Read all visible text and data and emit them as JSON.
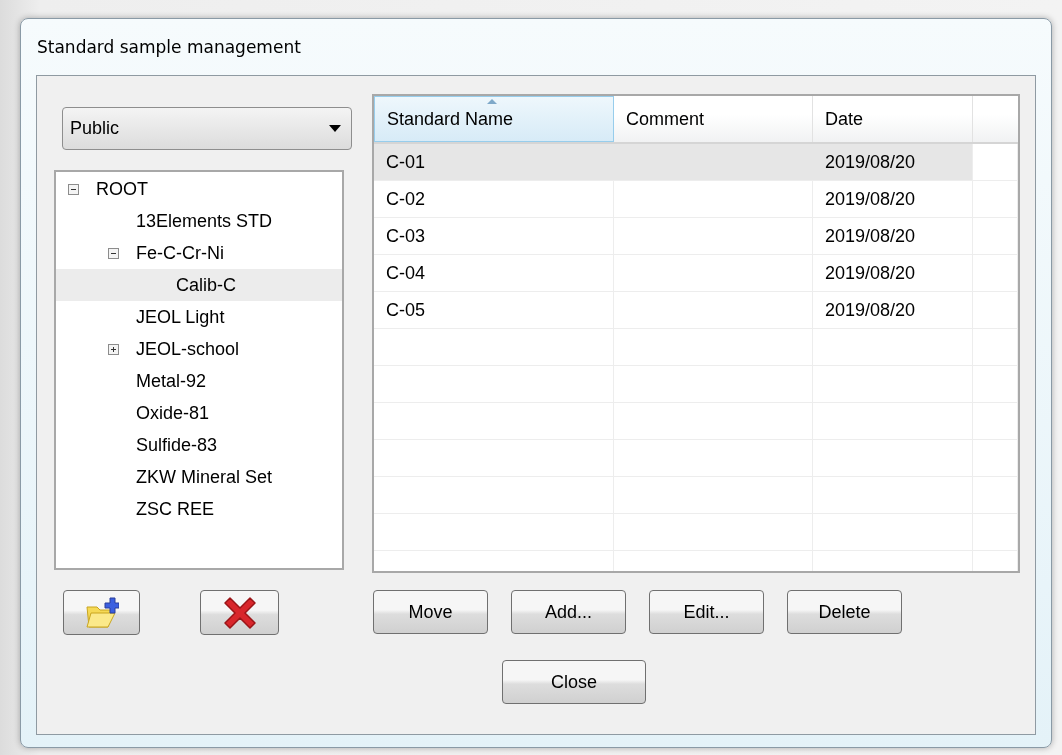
{
  "window": {
    "title": "Standard sample management"
  },
  "group_select": {
    "value": "Public"
  },
  "tree": [
    {
      "label": "ROOT",
      "expanded": true,
      "selected": false,
      "children": [
        {
          "label": "13Elements STD",
          "selected": false
        },
        {
          "label": "Fe-C-Cr-Ni",
          "expanded": true,
          "selected": false,
          "children": [
            {
              "label": "Calib-C",
              "selected": true
            }
          ]
        },
        {
          "label": "JEOL Light",
          "selected": false
        },
        {
          "label": "JEOL-school",
          "expanded": false,
          "selected": false
        },
        {
          "label": "Metal-92",
          "selected": false
        },
        {
          "label": "Oxide-81",
          "selected": false
        },
        {
          "label": "Sulfide-83",
          "selected": false
        },
        {
          "label": "ZKW Mineral Set",
          "selected": false
        },
        {
          "label": "ZSC REE",
          "selected": false
        }
      ]
    }
  ],
  "table": {
    "columns": [
      {
        "label": "Standard Name",
        "sorted": true
      },
      {
        "label": "Comment",
        "sorted": false
      },
      {
        "label": "Date",
        "sorted": false
      }
    ],
    "rows": [
      {
        "name": "C-01",
        "date": "2019/08/20",
        "selected": true
      },
      {
        "name": "C-02",
        "date": "2019/08/20",
        "selected": false
      },
      {
        "name": "C-03",
        "date": "2019/08/20",
        "selected": false
      },
      {
        "name": "C-04",
        "date": "2019/08/20",
        "selected": false
      },
      {
        "name": "C-05",
        "date": "2019/08/20",
        "selected": false
      }
    ]
  },
  "buttons": [
    "Move",
    "Add...",
    "Edit...",
    "Delete"
  ],
  "close_button": "Close"
}
